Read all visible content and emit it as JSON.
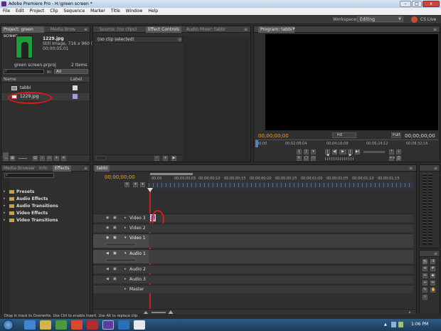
{
  "window": {
    "title": "Adobe Premiere Pro - H:\\green screen *",
    "min": "–",
    "max": "□",
    "close": "x"
  },
  "menu": [
    "File",
    "Edit",
    "Project",
    "Clip",
    "Sequence",
    "Marker",
    "Title",
    "Window",
    "Help"
  ],
  "workspace": {
    "label": "Workspace:",
    "value": "Editing",
    "cs_live": "CS Live"
  },
  "project_panel": {
    "tabs": [
      "Project: green screen",
      "Media Brow"
    ],
    "clip_name": "1229.jpg",
    "clip_type": "Still Image, 716 x 960 (...",
    "clip_duration": "00;00;05;01",
    "project_file": "green screen.prproj",
    "item_count": "2 Items",
    "in_label": "In:",
    "in_value": "All",
    "col_name": "Name",
    "col_label": "Label",
    "items": [
      {
        "name": "tabbi",
        "label_color": "#d8d8d8"
      },
      {
        "name": "1229.jpg",
        "label_color": "#a69bd4"
      }
    ]
  },
  "source_panel": {
    "tabs": [
      "Source: (no clips)",
      "Effect Controls",
      "Audio Mixer: tabbi"
    ],
    "no_clip": "(no clip selected)"
  },
  "program_monitor": {
    "tab": "Program: tabbi",
    "timecode_left": "00;00;00;00",
    "fit": "Fit",
    "full": "Full",
    "timecode_right": "00;00;00;00",
    "ruler": [
      "00;00",
      "00;02;08;04",
      "00;04;16;08",
      "00;06;24;12",
      "00;08;32;16"
    ]
  },
  "effects_panel": {
    "tabs": [
      "Media Browser",
      "Info",
      "Effects"
    ],
    "folders": [
      "Presets",
      "Audio Effects",
      "Audio Transitions",
      "Video Effects",
      "Video Transitions"
    ]
  },
  "timeline": {
    "tab": "tabbi",
    "timecode": "00;00;00;00",
    "ruler": [
      "00;00",
      "00;00;00;05",
      "00;00;00;10",
      "00;00;00;15",
      "00;00;00;20",
      "00;00;00;25",
      "00;00;01;00",
      "00;00;01;05",
      "00;00;01;10",
      "00;00;01;15"
    ],
    "video_tracks": [
      "Video 3",
      "Video 2",
      "Video 1"
    ],
    "audio_tracks": [
      "Audio 1",
      "Audio 2",
      "Audio 3"
    ],
    "master": "Master",
    "clip_on_v3": "12"
  },
  "status_bar": "Drop in track to Overwrite. Use Ctrl to enable Insert. Use Alt to replace clip.",
  "taskbar": {
    "clock": "1:06 PM"
  },
  "colors": {
    "accent_orange": "#e8a23a",
    "annotation_red": "#d81b1b",
    "playhead_red": "#c82020"
  }
}
